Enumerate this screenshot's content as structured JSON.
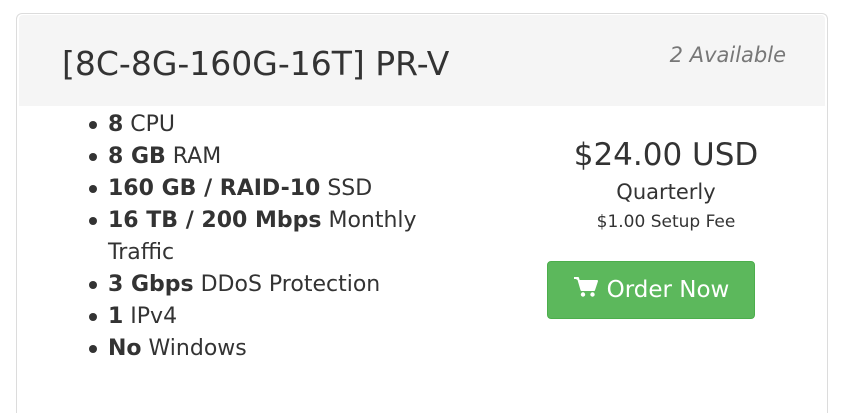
{
  "product": {
    "title": "[8C-8G-160G-16T] PR-V",
    "availability": "2 Available"
  },
  "features": [
    {
      "bold": "8",
      "text": " CPU"
    },
    {
      "bold": "8 GB",
      "text": " RAM"
    },
    {
      "bold": "160 GB / RAID-10",
      "text": " SSD"
    },
    {
      "bold": "16 TB / 200 Mbps",
      "text": " Monthly Traffic"
    },
    {
      "bold": "3 Gbps",
      "text": " DDoS Protection"
    },
    {
      "bold": "1",
      "text": " IPv4"
    },
    {
      "bold": "No",
      "text": " Windows"
    }
  ],
  "pricing": {
    "price": "$24.00 USD",
    "cycle": "Quarterly",
    "setup_fee": "$1.00 Setup Fee"
  },
  "order_button": {
    "label": "Order Now",
    "icon": "shopping-cart-icon"
  },
  "colors": {
    "button_bg": "#5cb85c",
    "header_bg": "#f5f5f5"
  }
}
